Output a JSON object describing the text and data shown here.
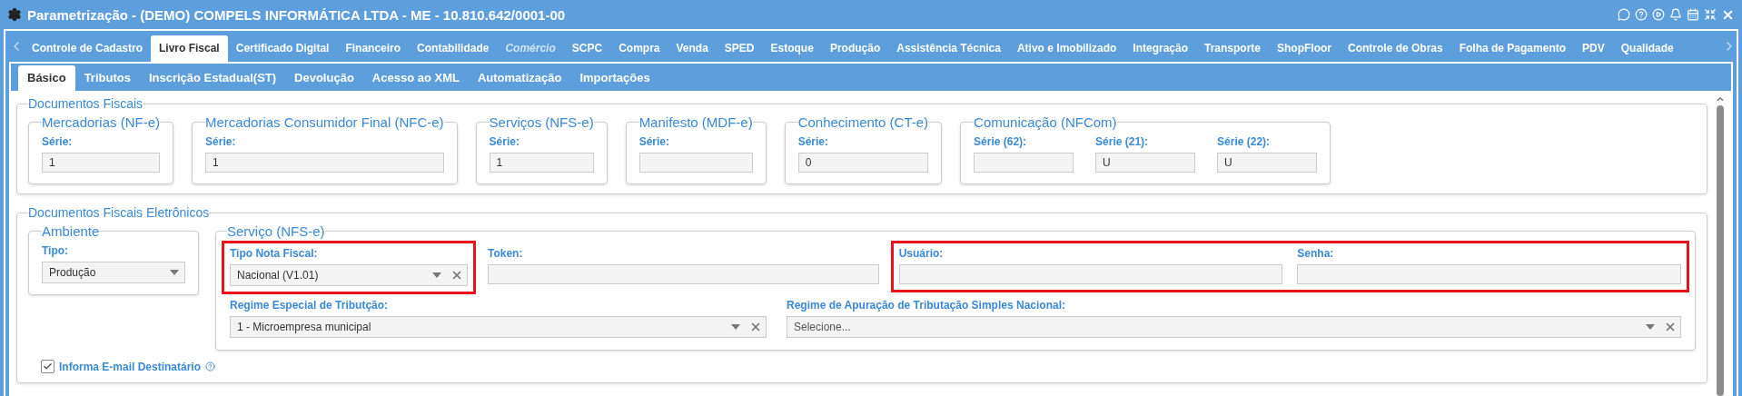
{
  "window": {
    "title": "Parametrização - (DEMO) COMPELS INFORMÁTICA LTDA - ME - 10.810.642/0001-00"
  },
  "tabs": [
    {
      "label": "Controle de Cadastro",
      "selected": false,
      "disabled": false
    },
    {
      "label": "Livro Fiscal",
      "selected": true,
      "disabled": false
    },
    {
      "label": "Certificado Digital",
      "selected": false,
      "disabled": false
    },
    {
      "label": "Financeiro",
      "selected": false,
      "disabled": false
    },
    {
      "label": "Contabilidade",
      "selected": false,
      "disabled": false
    },
    {
      "label": "Comércio",
      "selected": false,
      "disabled": true
    },
    {
      "label": "SCPC",
      "selected": false,
      "disabled": false
    },
    {
      "label": "Compra",
      "selected": false,
      "disabled": false
    },
    {
      "label": "Venda",
      "selected": false,
      "disabled": false
    },
    {
      "label": "SPED",
      "selected": false,
      "disabled": false
    },
    {
      "label": "Estoque",
      "selected": false,
      "disabled": false
    },
    {
      "label": "Produção",
      "selected": false,
      "disabled": false
    },
    {
      "label": "Assistência Técnica",
      "selected": false,
      "disabled": false
    },
    {
      "label": "Ativo e Imobilizado",
      "selected": false,
      "disabled": false
    },
    {
      "label": "Integração",
      "selected": false,
      "disabled": false
    },
    {
      "label": "Transporte",
      "selected": false,
      "disabled": false
    },
    {
      "label": "ShopFloor",
      "selected": false,
      "disabled": false
    },
    {
      "label": "Controle de Obras",
      "selected": false,
      "disabled": false
    },
    {
      "label": "Folha de Pagamento",
      "selected": false,
      "disabled": false
    },
    {
      "label": "PDV",
      "selected": false,
      "disabled": false
    },
    {
      "label": "Qualidade",
      "selected": false,
      "disabled": false
    }
  ],
  "subtabs": [
    {
      "label": "Básico",
      "selected": true
    },
    {
      "label": "Tributos",
      "selected": false
    },
    {
      "label": "Inscrição Estadual(ST)",
      "selected": false
    },
    {
      "label": "Devolução",
      "selected": false
    },
    {
      "label": "Acesso ao XML",
      "selected": false
    },
    {
      "label": "Automatização",
      "selected": false
    },
    {
      "label": "Importações",
      "selected": false
    }
  ],
  "documentos_fiscais": {
    "legend": "Documentos Fiscais",
    "groups": [
      {
        "legend": "Mercadorias (NF-e)",
        "fields": [
          {
            "label": "Série:",
            "value": "1"
          }
        ]
      },
      {
        "legend": "Mercadorias Consumidor Final (NFC-e)",
        "fields": [
          {
            "label": "Série:",
            "value": "1"
          }
        ]
      },
      {
        "legend": "Serviços (NFS-e)",
        "fields": [
          {
            "label": "Série:",
            "value": "1"
          }
        ]
      },
      {
        "legend": "Manifesto (MDF-e)",
        "fields": [
          {
            "label": "Série:"
          }
        ]
      },
      {
        "legend": "Conhecimento (CT-e)",
        "fields": [
          {
            "label": "Série:",
            "value": "0"
          }
        ]
      },
      {
        "legend": "Comunicação (NFCom)",
        "fields": [
          {
            "label": "Série (62):"
          },
          {
            "label": "Série (21):",
            "value": "U"
          },
          {
            "label": "Série (22):",
            "value": "U"
          }
        ]
      }
    ]
  },
  "documentos_eletronicos": {
    "legend": "Documentos Fiscais Eletrônicos",
    "ambiente": {
      "legend": "Ambiente",
      "field": {
        "kind": "select",
        "label": "Tipo:",
        "value": "Produção",
        "clearable": false
      }
    },
    "servico": {
      "legend": "Serviço (NFS-e)",
      "rows": [
        [
          {
            "highlighted": true,
            "fields": [
              {
                "kind": "select",
                "label": "Tipo Nota Fiscal:",
                "value": "Nacional (V1.01)",
                "clearable": true
              }
            ]
          },
          {
            "highlighted": false,
            "fields": [
              {
                "kind": "text",
                "label": "Token:"
              }
            ]
          },
          {
            "highlighted": true,
            "fields": [
              {
                "kind": "text",
                "label": "Usuário:"
              },
              {
                "kind": "text",
                "label": "Senha:"
              }
            ]
          }
        ],
        [
          {
            "highlighted": false,
            "fields": [
              {
                "kind": "select",
                "label": "Regime Especial de Tributção:",
                "value": "1 - Microempresa municipal",
                "clearable": true
              }
            ]
          },
          {
            "highlighted": false,
            "fields": [
              {
                "kind": "select",
                "label": "Regime de Apuração de Tributação Simples Nacional:",
                "placeholder": "Selecione...",
                "clearable": true
              }
            ]
          }
        ]
      ]
    },
    "checkbox": {
      "label": "Informa E-mail Destinatário",
      "checked": true
    }
  }
}
